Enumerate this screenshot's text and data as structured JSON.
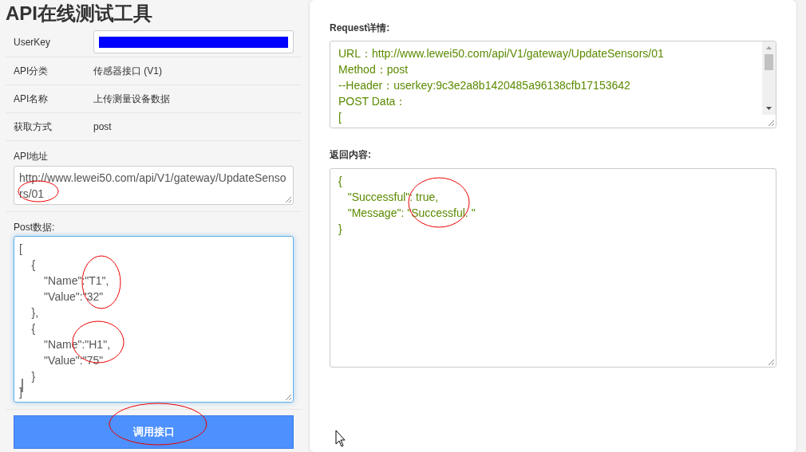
{
  "title": "API在线测试工具",
  "fields": [
    {
      "label": "UserKey",
      "kind": "redacted"
    },
    {
      "label": "API分类",
      "value": "传感器接口 (V1)"
    },
    {
      "label": "API名称",
      "value": "上传测量设备数据"
    },
    {
      "label": "获取方式",
      "value": "post"
    }
  ],
  "api_address": {
    "label": "API地址",
    "value": "http://www.lewei50.com/api/V1/gateway/UpdateSensors/01"
  },
  "post_data": {
    "label": "Post数据:",
    "focused": true,
    "lines": [
      "[",
      "    {",
      "        \"Name\":\"T1\",",
      "        \"Value\":\"32\"",
      "    },",
      "    {",
      "        \"Name\":\"H1\",",
      "        \"Value\":\"75\"",
      "    }",
      "]"
    ]
  },
  "call_button": "调用接口",
  "request": {
    "label": "Request详情:",
    "lines": [
      "URL：http://www.lewei50.com/api/V1/gateway/UpdateSensors/01",
      "Method：post",
      "--Header：userkey:9c3e2a8b1420485a96138cfb17153642",
      "POST Data：",
      "["
    ]
  },
  "response": {
    "label": "返回内容:",
    "lines": [
      "{",
      "   \"Successful\": true,",
      "   \"Message\": \"Successful. \"",
      "}"
    ]
  }
}
